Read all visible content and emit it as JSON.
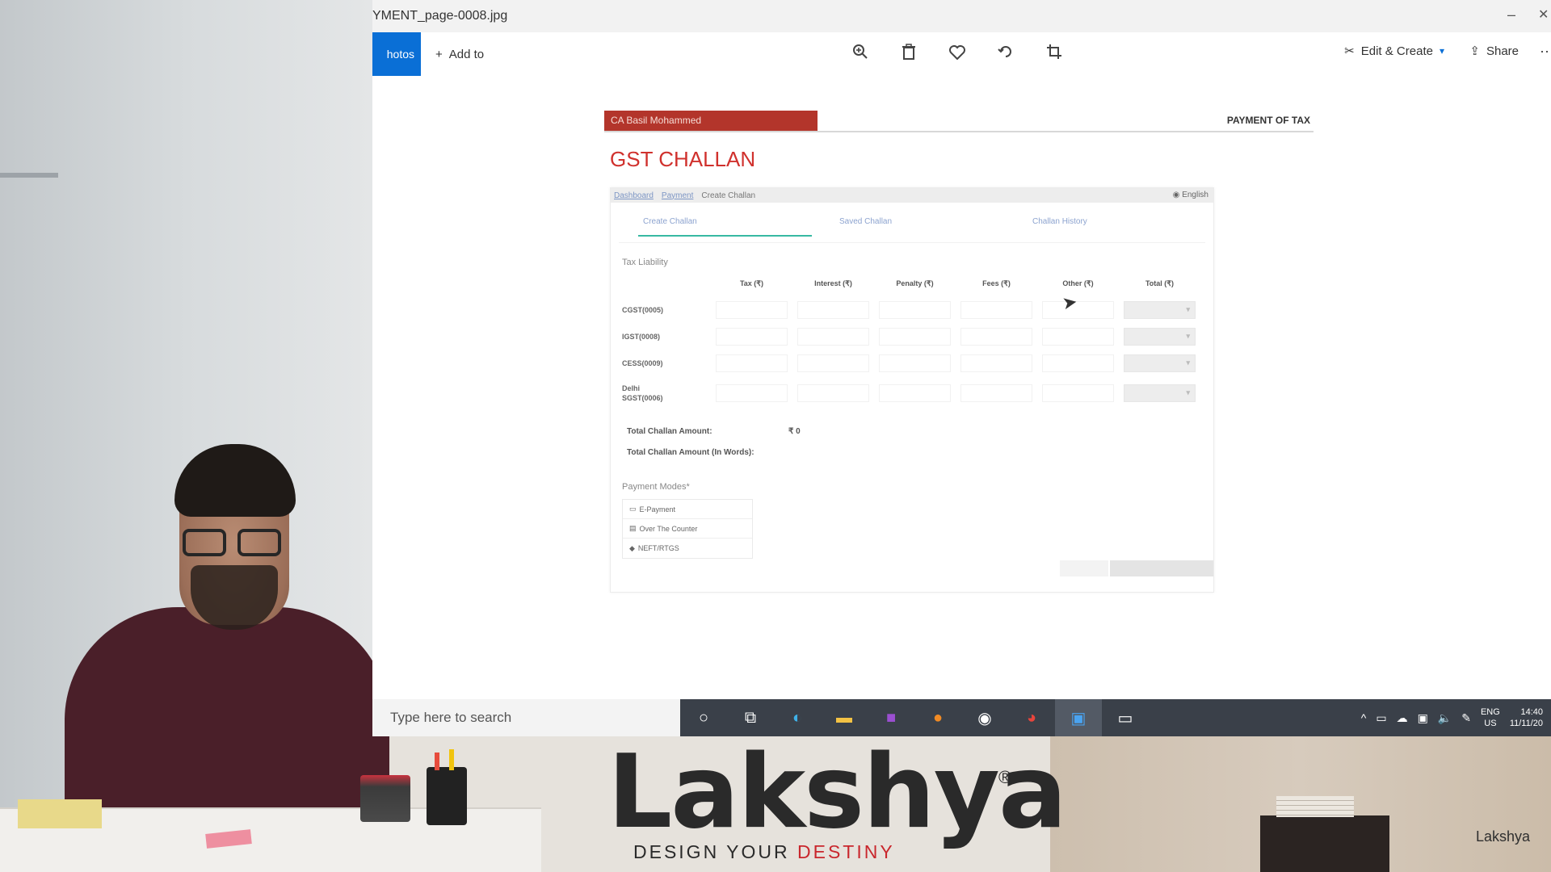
{
  "window": {
    "title": "YMENT_page-0008.jpg",
    "minimize_glyph": "–",
    "close_glyph": "✕"
  },
  "toolbar": {
    "photos_tab": "hotos",
    "add_to": "Add to",
    "icons": [
      "zoom-in-icon",
      "delete-icon",
      "favorite-icon",
      "rotate-icon",
      "crop-icon"
    ],
    "edit_create": "Edit & Create",
    "share": "Share"
  },
  "document": {
    "author": "CA Basil Mohammed",
    "section": "PAYMENT OF TAX",
    "title": "GST CHALLAN",
    "portal": {
      "breadcrumbs": [
        "Dashboard",
        "Payment",
        "Create Challan"
      ],
      "language": "English",
      "tabs": [
        "Create Challan",
        "Saved Challan",
        "Challan History"
      ],
      "section_label": "Tax Liability",
      "columns": [
        "Tax (₹)",
        "Interest (₹)",
        "Penalty (₹)",
        "Fees (₹)",
        "Other (₹)",
        "Total (₹)"
      ],
      "rows": [
        "CGST(0005)",
        "IGST(0008)",
        "CESS(0009)",
        "Delhi SGST(0006)"
      ],
      "total_amount_label": "Total Challan Amount:",
      "total_amount_value": "₹ 0",
      "total_words_label": "Total Challan Amount (In Words):",
      "payment_modes_label": "Payment Modes*",
      "payment_modes": [
        "E-Payment",
        "Over The Counter",
        "NEFT/RTGS"
      ]
    }
  },
  "taskbar": {
    "search_placeholder": "Type here to search",
    "apps": [
      "cortana-icon",
      "task-view-icon",
      "edge-icon",
      "file-explorer-icon",
      "onenote-icon",
      "app-ix-icon",
      "obs-icon",
      "chrome-icon",
      "photos-icon",
      "feedback-icon"
    ],
    "language": "ENG",
    "region": "US",
    "time": "14:40",
    "date": "11/11/20"
  },
  "branding": {
    "logo": "Lakshya",
    "tagline_prefix": "DESIGN YOUR ",
    "tagline_accent": "DESTINY",
    "corner_watermark": "Lakshya"
  },
  "colors": {
    "accent_blue": "#0a6fd6",
    "author_bar": "#b3352b",
    "title_red": "#d0312d",
    "tab_underline": "#37b9a2",
    "taskbar": "#3a4049"
  }
}
